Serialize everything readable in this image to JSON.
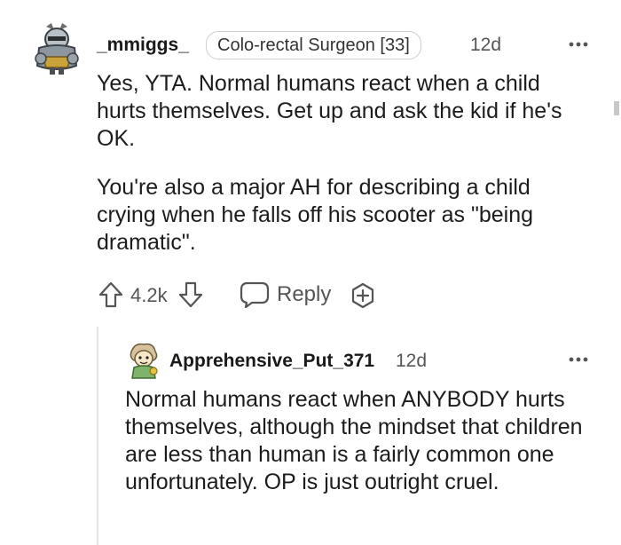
{
  "colors": {
    "text": "#1c1c1c",
    "muted": "#555555",
    "border": "#cfcfcf",
    "thread_line": "#e4e4e4"
  },
  "comment": {
    "username": "_mmiggs_",
    "flair": "Colo-rectal Surgeon [33]",
    "time": "12d",
    "paragraphs": [
      "Yes, YTA. Normal humans react when a child hurts themselves. Get up and ask the kid if he's OK.",
      "You're also a major AH for describing a child crying when he falls off his scooter as \"being dramatic\"."
    ],
    "votes": "4.2k",
    "reply_label": "Reply",
    "icons": {
      "avatar": "knight-avatar-icon",
      "upvote": "arrow-up-icon",
      "downvote": "arrow-down-icon",
      "reply": "speech-bubble-icon",
      "award": "add-award-icon",
      "more": "more-dots-icon"
    }
  },
  "reply": {
    "username": "Apprehensive_Put_371",
    "time": "12d",
    "text": "Normal humans react when ANYBODY hurts themselves, although the mindset that children are less than human is a fairly common one unfortunately. OP is just outright cruel.",
    "icons": {
      "avatar": "cartoon-avatar-icon",
      "more": "more-dots-icon"
    }
  }
}
